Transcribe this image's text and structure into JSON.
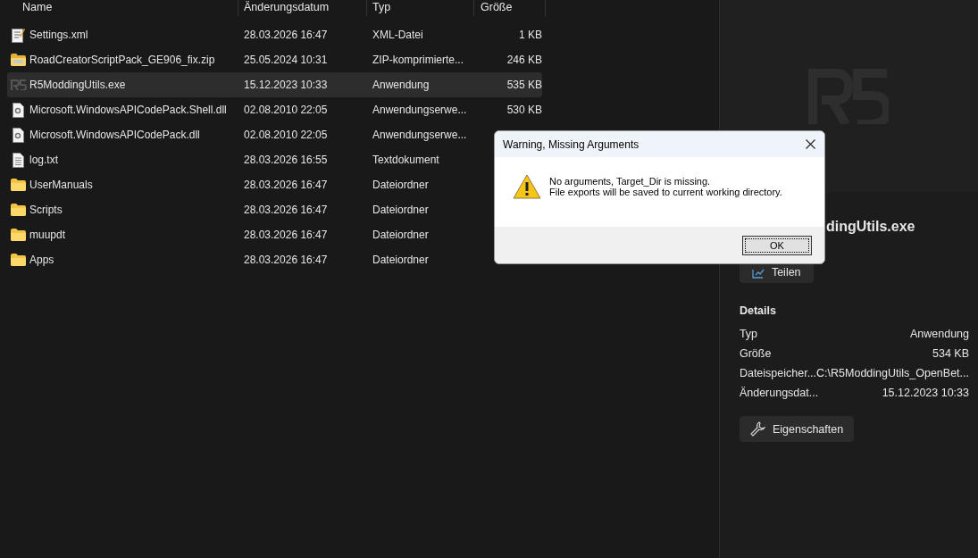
{
  "columns": [
    "Name",
    "Änderungsdatum",
    "Typ",
    "Größe"
  ],
  "files": [
    {
      "kind": "xml",
      "name": "Settings.xml",
      "date": "28.03.2026 16:47",
      "type": "XML-Datei",
      "size": "1 KB",
      "selected": false
    },
    {
      "kind": "zip",
      "name": "RoadCreatorScriptPack_GE906_fix.zip",
      "date": "25.05.2024 10:31",
      "type": "ZIP-komprimierte...",
      "size": "246 KB",
      "selected": false
    },
    {
      "kind": "exe",
      "name": "R5ModdingUtils.exe",
      "date": "15.12.2023 10:33",
      "type": "Anwendung",
      "size": "535 KB",
      "selected": true
    },
    {
      "kind": "dll",
      "name": "Microsoft.WindowsAPICodePack.Shell.dll",
      "date": "02.08.2010 22:05",
      "type": "Anwendungserwe...",
      "size": "530 KB",
      "selected": false
    },
    {
      "kind": "dll",
      "name": "Microsoft.WindowsAPICodePack.dll",
      "date": "02.08.2010 22:05",
      "type": "Anwendungserwe...",
      "selected": false
    },
    {
      "kind": "txt",
      "name": "log.txt",
      "date": "28.03.2026 16:55",
      "type": "Textdokument",
      "selected": false
    },
    {
      "kind": "folder",
      "name": "UserManuals",
      "date": "28.03.2026 16:47",
      "type": "Dateiordner",
      "selected": false
    },
    {
      "kind": "folder",
      "name": "Scripts",
      "date": "28.03.2026 16:47",
      "type": "Dateiordner",
      "selected": false
    },
    {
      "kind": "folder",
      "name": "muupdt",
      "date": "28.03.2026 16:47",
      "type": "Dateiordner",
      "selected": false
    },
    {
      "kind": "folder",
      "name": "Apps",
      "date": "28.03.2026 16:47",
      "type": "Dateiordner",
      "selected": false
    }
  ],
  "preview": {
    "title": "dingUtils.exe",
    "share_button": "Teilen",
    "details_heading": "Details",
    "details": [
      {
        "label": "Typ",
        "value": "Anwendung"
      },
      {
        "label": "Größe",
        "value": "534 KB"
      },
      {
        "label": "Dateispeicher...",
        "value": "C:\\R5ModdingUtils_OpenBet..."
      },
      {
        "label": "Änderungsdat...",
        "value": "15.12.2023 10:33"
      }
    ],
    "properties_button": "Eigenschaften"
  },
  "dialog": {
    "title": "Warning, Missing Arguments",
    "message": [
      "No arguments, Target_Dir is missing.",
      "File exports will be saved to current working directory."
    ],
    "ok_button": "OK"
  }
}
